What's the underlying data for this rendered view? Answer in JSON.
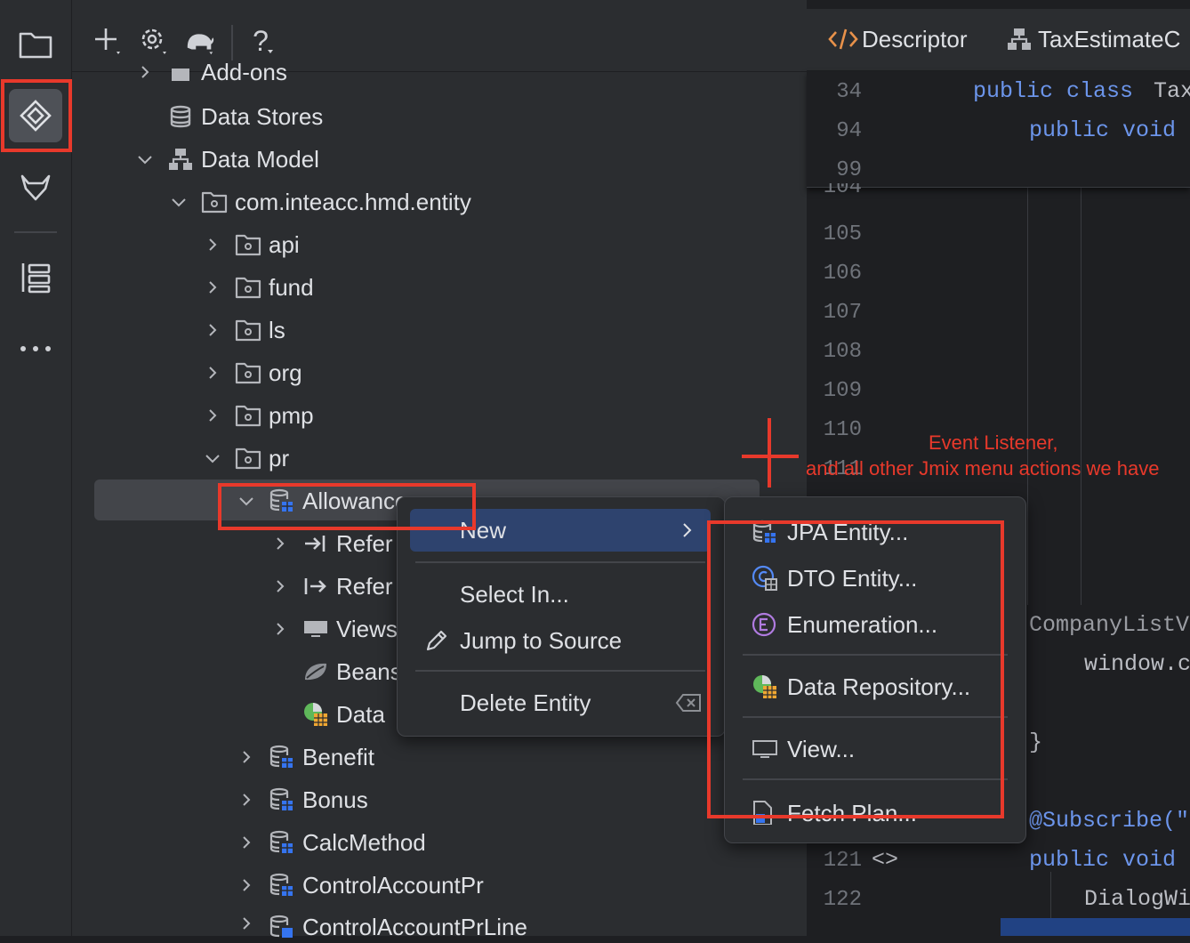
{
  "toolbar": {
    "help_label": "?"
  },
  "tree": {
    "rows": [
      {
        "label": "Add-ons"
      },
      {
        "label": "Data Stores"
      },
      {
        "label": "Data Model"
      },
      {
        "label": "com.inteacc.hmd.entity"
      },
      {
        "label": "api"
      },
      {
        "label": "fund"
      },
      {
        "label": "ls"
      },
      {
        "label": "org"
      },
      {
        "label": "pmp"
      },
      {
        "label": "pr"
      },
      {
        "label": "Allowance"
      },
      {
        "label": "Refer"
      },
      {
        "label": "Refer"
      },
      {
        "label": "Views"
      },
      {
        "label": "Beans"
      },
      {
        "label": "Data"
      },
      {
        "label": "Benefit"
      },
      {
        "label": "Bonus"
      },
      {
        "label": "CalcMethod"
      },
      {
        "label": "ControlAccountPr"
      },
      {
        "label": "ControlAccountPrLine"
      }
    ]
  },
  "editor": {
    "tabs": [
      {
        "label": "Descriptor"
      },
      {
        "label": "TaxEstimateC"
      }
    ],
    "lines": [
      {
        "num": "34"
      },
      {
        "num": "94"
      },
      {
        "num": "99"
      },
      {
        "num": "104"
      },
      {
        "num": "105"
      },
      {
        "num": "106"
      },
      {
        "num": "107"
      },
      {
        "num": "108"
      },
      {
        "num": "109"
      },
      {
        "num": "110"
      },
      {
        "num": "111"
      },
      {
        "num": "121"
      },
      {
        "num": "122"
      }
    ],
    "code": {
      "public_class": "public class",
      "tax": "Tax",
      "public_void_1": "public void",
      "company": "CompanyListV",
      "window": "window.c",
      "brace": "}",
      "subscribe": "@Subscribe(\"",
      "public_void_2": "public void",
      "dialog": "DialogWi",
      "gutter_121": "<>"
    }
  },
  "annotation": {
    "line1": "Event Listener,",
    "line2": "and all other Jmix menu actions we have"
  },
  "context_menu": {
    "new_label": "New",
    "select_in_label": "Select In...",
    "jump_label": "Jump to Source",
    "delete_label": "Delete Entity"
  },
  "submenu": {
    "jpa_label": "JPA Entity...",
    "dto_label": "DTO Entity...",
    "enum_label": "Enumeration...",
    "repo_label": "Data Repository...",
    "view_label": "View...",
    "fetch_label": "Fetch Plan..."
  },
  "colors": {
    "highlight_red": "#e8392b",
    "menu_selection": "#2e436e",
    "tree_selection": "#43454a"
  }
}
